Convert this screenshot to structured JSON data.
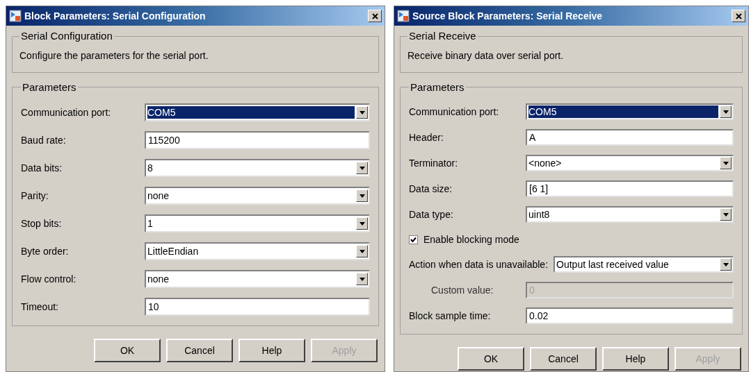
{
  "dialogs": [
    {
      "title": "Block Parameters: Serial Configuration",
      "description_group": {
        "title": "Serial Configuration",
        "text": "Configure the parameters for the serial port."
      },
      "parameters": {
        "title": "Parameters",
        "fields": [
          {
            "kind": "dropdown",
            "label": "Communication port:",
            "value": "COM5",
            "selected": true
          },
          {
            "kind": "text",
            "label": "Baud rate:",
            "value": "115200",
            "disabled": false
          },
          {
            "kind": "dropdown",
            "label": "Data bits:",
            "value": "8",
            "selected": false
          },
          {
            "kind": "dropdown",
            "label": "Parity:",
            "value": "none",
            "selected": false
          },
          {
            "kind": "dropdown",
            "label": "Stop bits:",
            "value": "1",
            "selected": false
          },
          {
            "kind": "dropdown",
            "label": "Byte order:",
            "value": "LittleEndian",
            "selected": false
          },
          {
            "kind": "dropdown",
            "label": "Flow control:",
            "value": "none",
            "selected": false
          },
          {
            "kind": "text",
            "label": "Timeout:",
            "value": "10",
            "disabled": false
          }
        ]
      },
      "buttons": [
        {
          "label": "OK",
          "disabled": false
        },
        {
          "label": "Cancel",
          "disabled": false
        },
        {
          "label": "Help",
          "disabled": false
        },
        {
          "label": "Apply",
          "disabled": true
        }
      ]
    },
    {
      "title": "Source Block Parameters: Serial Receive",
      "description_group": {
        "title": "Serial Receive",
        "text": "Receive binary data over serial port."
      },
      "parameters": {
        "title": "Parameters",
        "fields": [
          {
            "kind": "dropdown",
            "label": "Communication port:",
            "value": "COM5",
            "selected": true
          },
          {
            "kind": "text",
            "label": "Header:",
            "value": "A",
            "disabled": false
          },
          {
            "kind": "dropdown",
            "label": "Terminator:",
            "value": "<none>",
            "selected": false
          },
          {
            "kind": "text",
            "label": "Data size:",
            "value": "[6  1]",
            "disabled": false
          },
          {
            "kind": "dropdown",
            "label": "Data type:",
            "value": "uint8",
            "selected": false
          },
          {
            "kind": "checkbox",
            "label": "Enable blocking mode",
            "checked": true
          },
          {
            "kind": "dropdown",
            "label": "Action when data is unavailable:",
            "value": "Output last received value",
            "selected": false
          },
          {
            "kind": "text",
            "label": "Custom value:",
            "value": "0",
            "disabled": true
          },
          {
            "kind": "text",
            "label": "Block sample time:",
            "value": "0.02",
            "disabled": false
          }
        ]
      },
      "buttons": [
        {
          "label": "OK",
          "disabled": false
        },
        {
          "label": "Cancel",
          "disabled": false
        },
        {
          "label": "Help",
          "disabled": false
        },
        {
          "label": "Apply",
          "disabled": true
        }
      ]
    }
  ]
}
